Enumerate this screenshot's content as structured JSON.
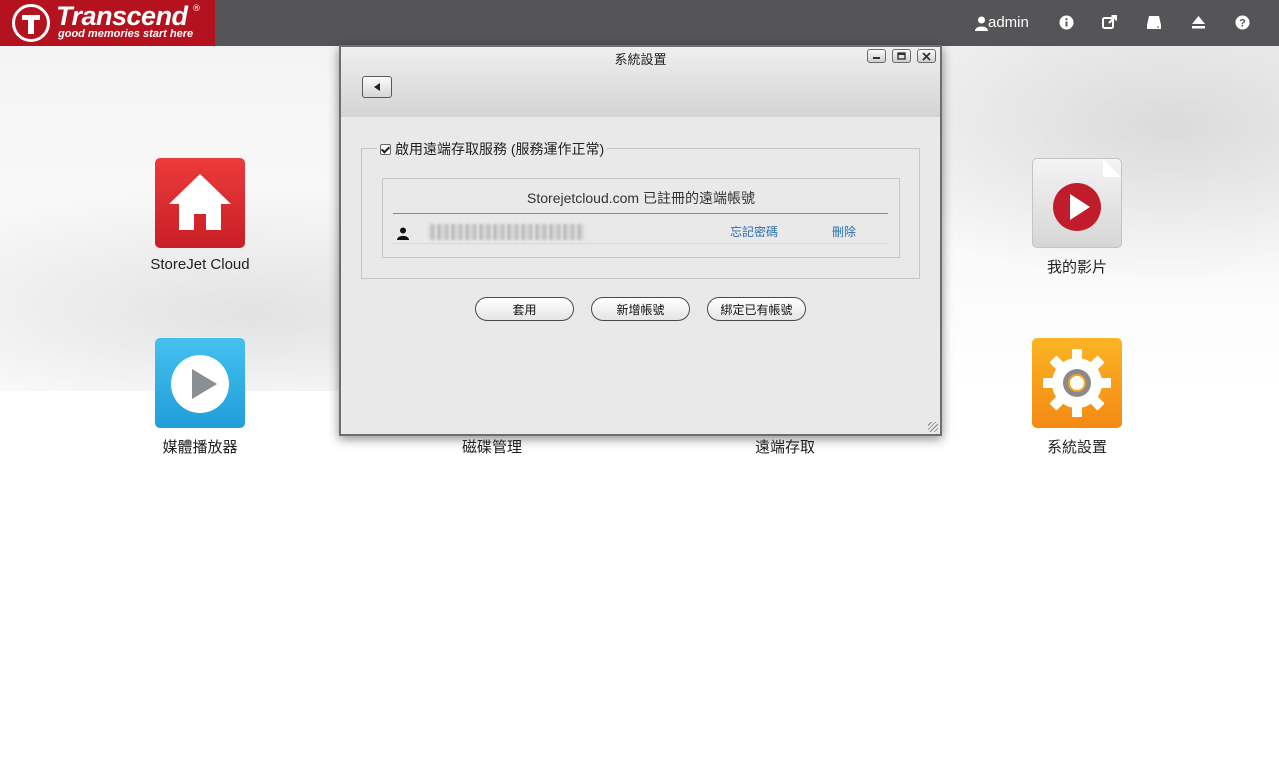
{
  "header": {
    "logo": {
      "name": "Transcend",
      "tagline": "good memories start here",
      "reg": "®"
    },
    "user": {
      "label": "admin",
      "icon": "user-icon"
    },
    "icons": [
      "info-icon",
      "external-link-icon",
      "drive-icon",
      "eject-icon",
      "help-icon"
    ]
  },
  "desktop": {
    "apps": [
      {
        "label": "StoreJet Cloud",
        "icon": "home-icon",
        "color": "#d9252c"
      },
      {
        "label": "我的影片",
        "icon": "video-play-icon",
        "color": "#e4e4e4"
      },
      {
        "label": "媒體播放器",
        "icon": "media-player-icon",
        "color": "#2aa7e0"
      },
      {
        "label": "磁碟管理",
        "icon": "disk-icon"
      },
      {
        "label": "遠端存取",
        "icon": "remote-icon"
      },
      {
        "label": "系統設置",
        "icon": "gear-icon",
        "color": "#f58e1a"
      }
    ]
  },
  "window": {
    "title": "系統設置",
    "controls": [
      "minimize-icon",
      "maximize-icon",
      "close-icon"
    ],
    "back_icon": "back-arrow-icon",
    "remote_access": {
      "checkbox_checked": true,
      "legend": "啟用遠端存取服務 (服務運作正常)",
      "accounts_heading": "Storejetcloud.com 已註冊的遠端帳號",
      "account": {
        "icon": "user-icon",
        "forgot_password": "忘記密碼",
        "delete": "刪除"
      }
    },
    "buttons": {
      "apply": "套用",
      "new_account": "新增帳號",
      "bind_account": "綁定已有帳號"
    }
  },
  "colors": {
    "topbar": "#555558",
    "brand": "#b3121e",
    "link": "#2a6fb0"
  }
}
